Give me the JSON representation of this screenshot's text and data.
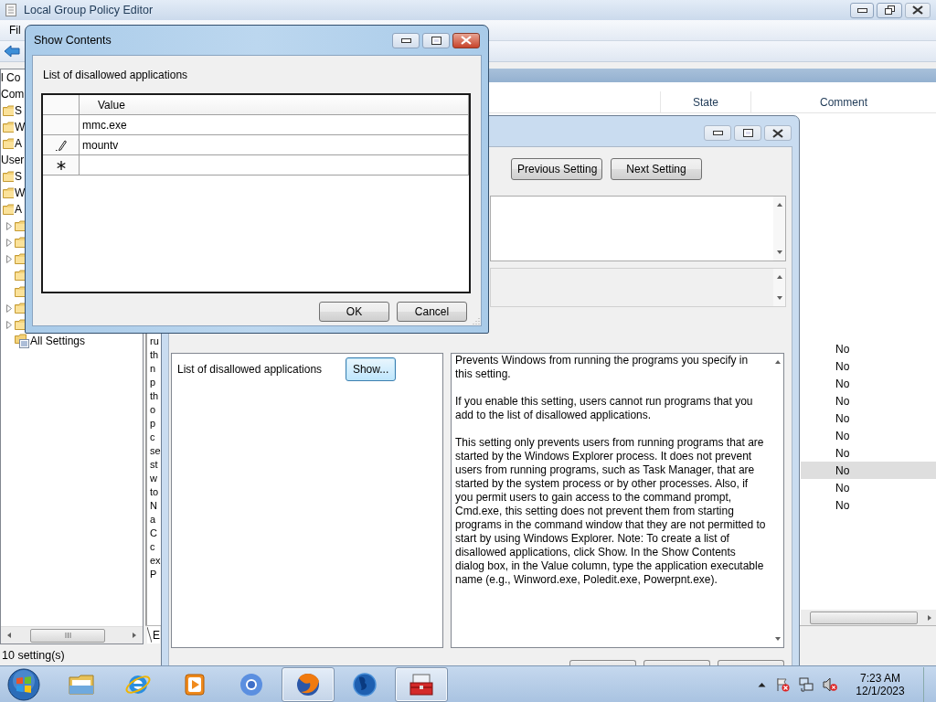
{
  "main_window": {
    "title": "Local Group Policy Editor",
    "menu": [
      "Fil"
    ],
    "tree": [
      {
        "label": "l Co",
        "children": [
          {
            "label": "Com",
            "children": [
              {
                "kind": "folder",
                "label": "S"
              },
              {
                "kind": "folder",
                "label": "W"
              },
              {
                "kind": "folder",
                "label": "A"
              }
            ]
          },
          {
            "label": "User",
            "children": [
              {
                "kind": "folder",
                "label": "S"
              },
              {
                "kind": "folder",
                "label": "W"
              },
              {
                "kind": "folder",
                "label": "A",
                "children": [
                  {
                    "kind": "folder",
                    "has_children": true
                  },
                  {
                    "kind": "folder",
                    "has_children": true
                  },
                  {
                    "kind": "folder",
                    "has_children": true
                  },
                  {
                    "kind": "folder",
                    "has_children": false
                  },
                  {
                    "kind": "folder",
                    "has_children": false
                  },
                  {
                    "kind": "folder",
                    "has_children": true
                  },
                  {
                    "kind": "folder",
                    "has_children": true
                  },
                  {
                    "kind": "settings",
                    "label": "All Settings",
                    "has_children": false
                  }
                ]
              }
            ]
          }
        ]
      }
    ],
    "results": {
      "columns": [
        "State",
        "Comment"
      ],
      "description_lines": [
        "ru",
        "th",
        "n",
        "p",
        "th",
        "o",
        "p",
        "c",
        "se",
        "st",
        "w",
        "to",
        "N",
        "a",
        "C",
        "c",
        "ex",
        "P"
      ],
      "rows": [
        {
          "comment": "No",
          "selected": false
        },
        {
          "comment": "No",
          "selected": false
        },
        {
          "comment": "No",
          "selected": false
        },
        {
          "comment": "No",
          "selected": false
        },
        {
          "comment": "No",
          "selected": false
        },
        {
          "comment": "No",
          "selected": false
        },
        {
          "comment": "No",
          "selected": false
        },
        {
          "comment": "No",
          "selected": true
        },
        {
          "comment": "No",
          "selected": false
        },
        {
          "comment": "No",
          "selected": false
        }
      ],
      "tab": "E"
    },
    "status": "10 setting(s)"
  },
  "setting_dialog": {
    "nav_buttons": [
      "Previous Setting",
      "Next Setting"
    ],
    "option_label": "List of disallowed applications",
    "show_button": "Show...",
    "help": [
      "Prevents Windows from running the programs you specify in this setting.",
      "If you enable this setting, users cannot run programs that you add to the list of disallowed applications.",
      "This setting only prevents users from running programs that are started by the Windows Explorer process. It does not prevent users from running programs, such as Task Manager, that are started by the system process or by other processes. Also, if you permit users to gain access to the command prompt, Cmd.exe, this setting does not prevent them from starting programs in the command window that they are not permitted to start by using Windows Explorer. Note: To create a list of disallowed applications, click Show. In the Show Contents dialog box, in the Value column, type the application executable name (e.g., Winword.exe, Poledit.exe, Powerpnt.exe)."
    ]
  },
  "show_contents": {
    "title": "Show Contents",
    "label": "List of disallowed applications",
    "column": "Value",
    "rows": [
      {
        "kind": "normal",
        "value": "mmc.exe"
      },
      {
        "kind": "editing",
        "value": "mountv"
      },
      {
        "kind": "new"
      }
    ],
    "buttons": [
      "OK",
      "Cancel"
    ]
  },
  "taskbar": {
    "apps": [
      {
        "active": false
      },
      {
        "active": false
      },
      {
        "active": false
      },
      {
        "active": false
      },
      {
        "active": true
      },
      {
        "active": false
      },
      {
        "active": true
      }
    ],
    "time": "7:23 AM",
    "date": "12/1/2023"
  }
}
